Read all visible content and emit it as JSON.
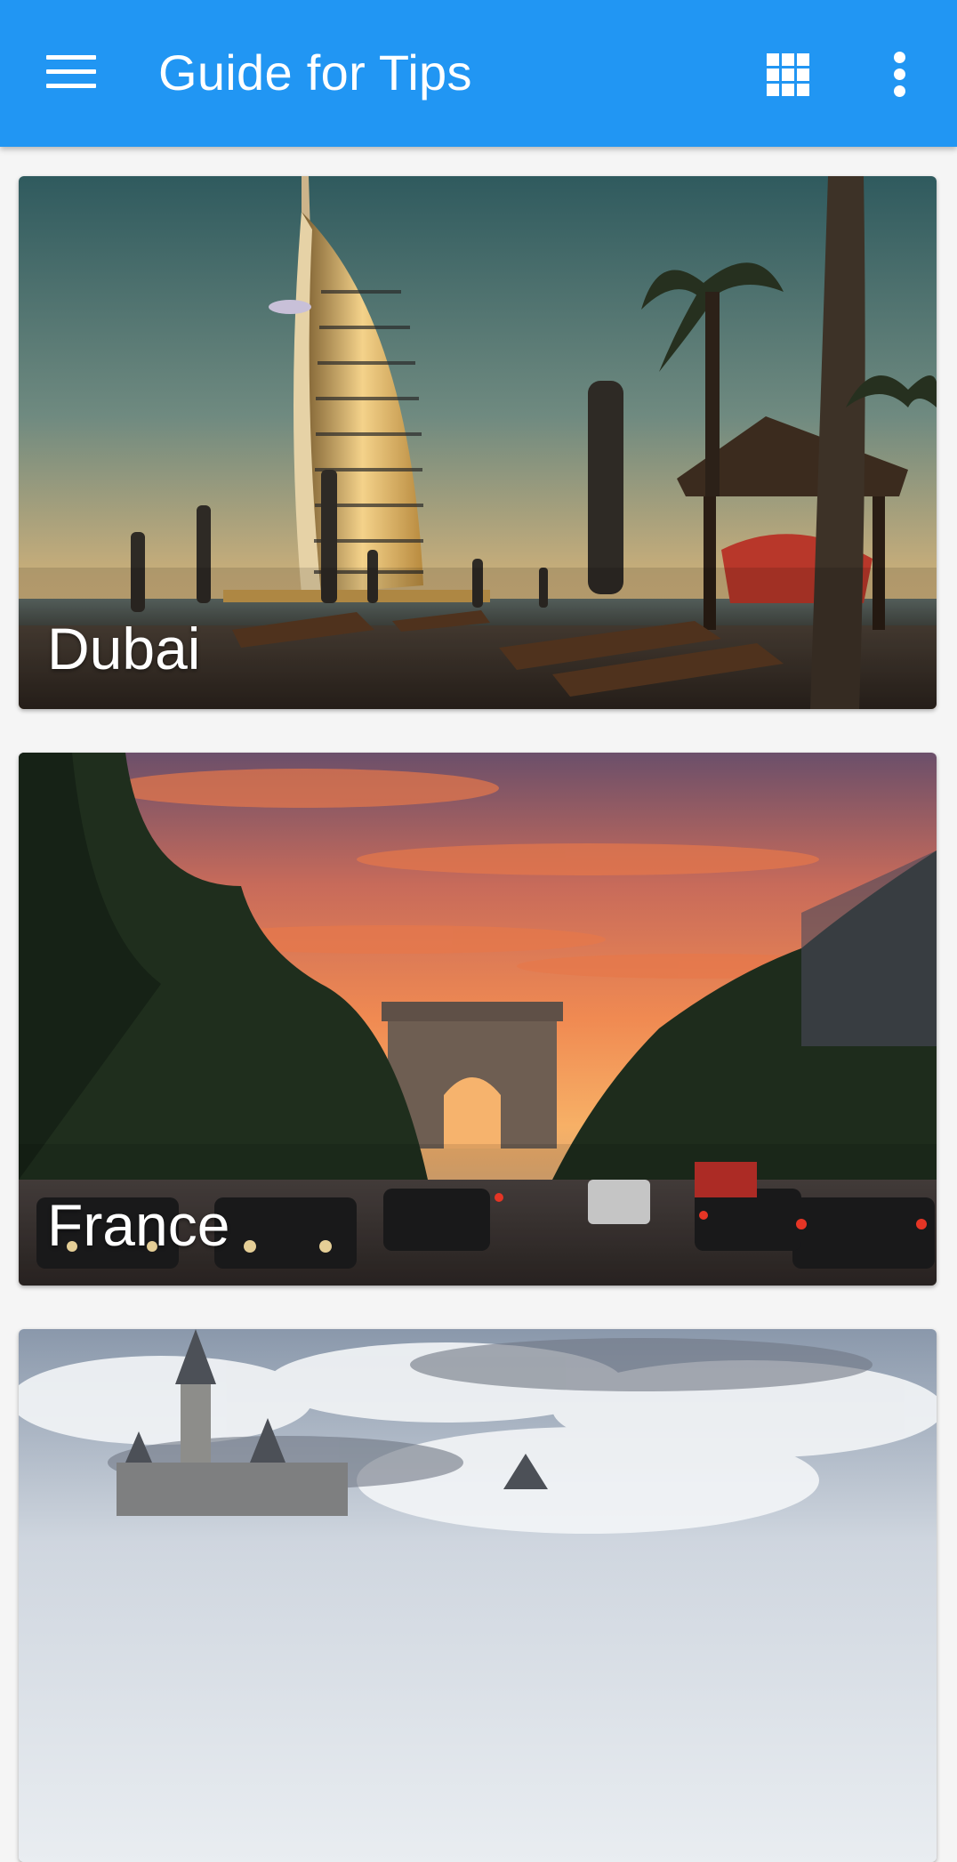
{
  "app_bar": {
    "title": "Guide for Tips",
    "background": "#2196f3",
    "menu_icon": "hamburger-menu-icon",
    "grid_icon": "grid-view-icon",
    "more_icon": "more-vert-icon"
  },
  "cards": [
    {
      "label": "Dubai",
      "scene": "burj-al-arab-beach-sunset"
    },
    {
      "label": "France",
      "scene": "arc-de-triomphe-sunset-avenue"
    },
    {
      "label": "",
      "scene": "castle-under-cloudy-sky"
    }
  ]
}
